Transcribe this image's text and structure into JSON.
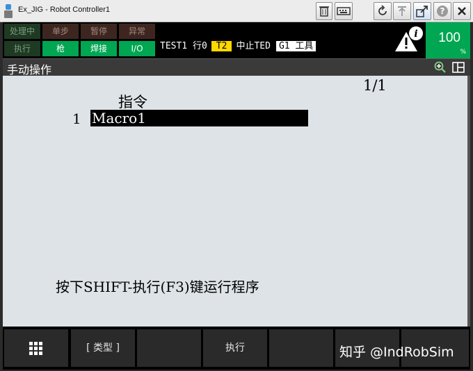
{
  "window": {
    "title": "Ex_JIG - Robot Controller1"
  },
  "status": {
    "buttons": [
      {
        "label": "处理中",
        "state": "dim"
      },
      {
        "label": "单步",
        "state": "dimr"
      },
      {
        "label": "暂停",
        "state": "dimr"
      },
      {
        "label": "异常",
        "state": "dimr"
      },
      {
        "label": "执行",
        "state": "dim"
      },
      {
        "label": "枪",
        "state": "green"
      },
      {
        "label": "焊接",
        "state": "green"
      },
      {
        "label": "I/O",
        "state": "green"
      }
    ],
    "program": "TEST1",
    "line": "行0",
    "mode": "T2",
    "state": "中止TED",
    "frame": "G1 工具",
    "override": "100",
    "override_unit": "%"
  },
  "header": {
    "title": "手动操作"
  },
  "content": {
    "page": "1/1",
    "column_title": "指令",
    "rows": [
      {
        "num": "1",
        "label": "Macro1"
      }
    ],
    "prompt": "按下SHIFT-执行(F3)键运行程序"
  },
  "fkeys": {
    "f1": "[ 类型 ]",
    "f2": "",
    "f3": "执行",
    "f4": ""
  },
  "watermark": "知乎 @IndRobSim",
  "colors": {
    "green": "#00a651",
    "mode_yellow": "#ffd800",
    "content_bg": "#dde3e6"
  }
}
